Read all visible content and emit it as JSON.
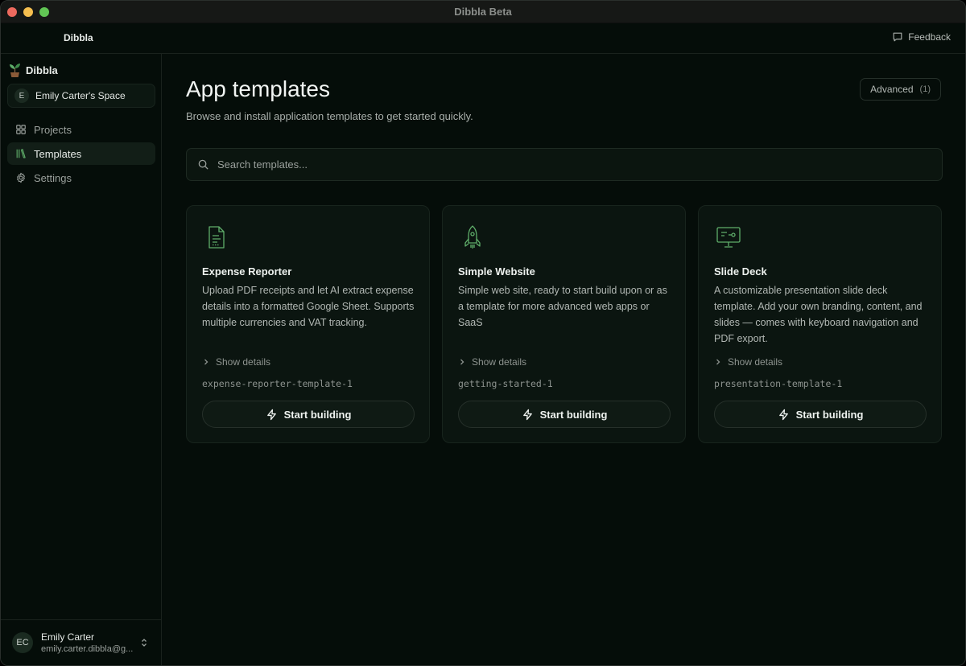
{
  "window": {
    "title": "Dibbla Beta"
  },
  "header": {
    "brand": "Dibbla",
    "feedback_label": "Feedback"
  },
  "sidebar": {
    "brand": "Dibbla",
    "space": {
      "initial": "E",
      "name": "Emily Carter's Space"
    },
    "items": [
      {
        "label": "Projects",
        "icon": "grid-icon",
        "active": false
      },
      {
        "label": "Templates",
        "icon": "library-icon",
        "active": true
      },
      {
        "label": "Settings",
        "icon": "gear-icon",
        "active": false
      }
    ],
    "user": {
      "initials": "EC",
      "name": "Emily Carter",
      "email": "emily.carter.dibbla@g..."
    }
  },
  "main": {
    "title": "App templates",
    "subtitle": "Browse and install application templates to get started quickly.",
    "advanced": {
      "label": "Advanced",
      "count": "(1)"
    },
    "search": {
      "placeholder": "Search templates...",
      "value": ""
    },
    "cards": [
      {
        "icon": "document-icon",
        "title": "Expense Reporter",
        "description": "Upload PDF receipts and let AI extract expense details into a formatted Google Sheet. Supports multiple currencies and VAT tracking.",
        "details_label": "Show details",
        "slug": "expense-reporter-template-1",
        "button_label": "Start building"
      },
      {
        "icon": "rocket-icon",
        "title": "Simple Website",
        "description": "Simple web site, ready to start build upon or as a template for more advanced web apps or SaaS",
        "details_label": "Show details",
        "slug": "getting-started-1",
        "button_label": "Start building"
      },
      {
        "icon": "presentation-icon",
        "title": "Slide Deck",
        "description": "A customizable presentation slide deck template. Add your own branding, content, and slides — comes with keyboard navigation and PDF export.",
        "details_label": "Show details",
        "slug": "presentation-template-1",
        "button_label": "Start building"
      }
    ]
  },
  "colors": {
    "accent_green": "#5fae6a",
    "background": "#050d09",
    "card": "#0b1510"
  }
}
